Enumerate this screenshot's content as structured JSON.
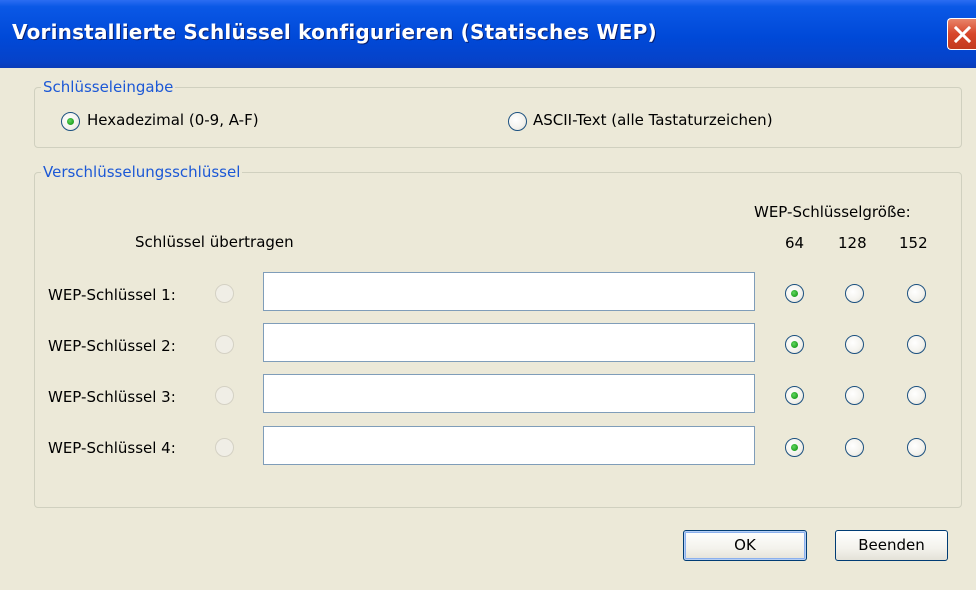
{
  "window": {
    "title": "Vorinstallierte Schlüssel konfigurieren (Statisches WEP)"
  },
  "key_input": {
    "group_label": "Schlüsseleingabe",
    "hex_label": "Hexadezimal (0-9, A-F)",
    "ascii_label": "ASCII-Text (alle Tastaturzeichen)",
    "selected": "hex"
  },
  "encryption": {
    "group_label": "Verschlüsselungsschlüssel",
    "transmit_header": "Schlüssel übertragen",
    "size_header": "WEP-Schlüsselgröße:",
    "sizes": [
      "64",
      "128",
      "152"
    ],
    "keys": [
      {
        "label": "WEP-Schlüssel 1:",
        "value": "",
        "selected_size": "64"
      },
      {
        "label": "WEP-Schlüssel 2:",
        "value": "",
        "selected_size": "64"
      },
      {
        "label": "WEP-Schlüssel 3:",
        "value": "",
        "selected_size": "64"
      },
      {
        "label": "WEP-Schlüssel 4:",
        "value": "",
        "selected_size": "64"
      }
    ]
  },
  "buttons": {
    "ok": "OK",
    "cancel": "Beenden"
  }
}
